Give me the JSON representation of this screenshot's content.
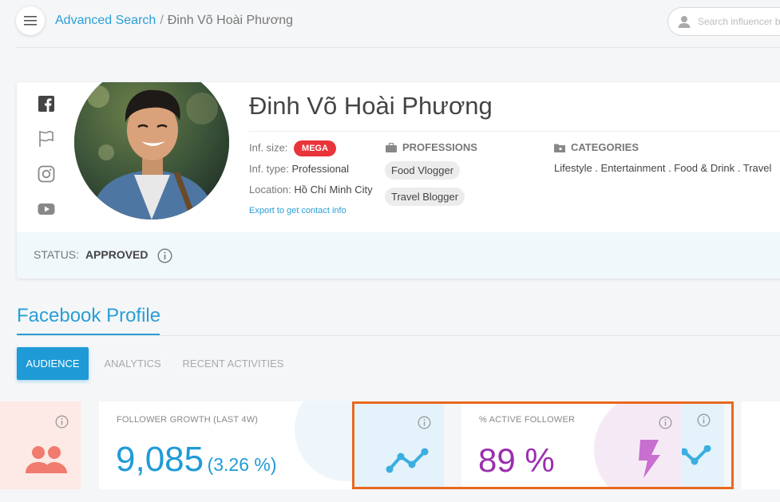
{
  "breadcrumb": {
    "parent": "Advanced Search",
    "separator": "/",
    "current": "Đinh Võ Hoài Phương"
  },
  "search": {
    "placeholder": "Search influencer by name"
  },
  "profile": {
    "name": "Đinh Võ Hoài Phương",
    "social_icons": [
      "facebook-icon",
      "flag-icon",
      "instagram-icon",
      "youtube-icon"
    ],
    "inf_size_label": "Inf. size:",
    "inf_size_badge": "MEGA",
    "inf_type_label": "Inf. type:",
    "inf_type_value": "Professional",
    "location_label": "Location:",
    "location_value": "Hồ Chí Minh City",
    "export_link": "Export to get contact info",
    "professions_heading": "PROFESSIONS",
    "professions": [
      "Food Vlogger",
      "Travel Blogger"
    ],
    "categories_heading": "CATEGORIES",
    "categories_value": "Lifestyle . Entertainment . Food & Drink . Travel",
    "status_label": "STATUS:",
    "status_value": "APPROVED"
  },
  "section": {
    "title": "Facebook Profile",
    "tabs": [
      "AUDIENCE",
      "ANALYTICS",
      "RECENT ACTIVITIES"
    ],
    "active_tab": "AUDIENCE"
  },
  "stats": {
    "follower_growth": {
      "label": "FOLLOWER GROWTH (LAST 4W)",
      "value": "9,085",
      "change": "(3.26 %)"
    },
    "active_follower": {
      "label": "% ACTIVE FOLLOWER",
      "value": "89 %"
    }
  },
  "colors": {
    "accent": "#2a9fd6",
    "badge_red": "#e9343a",
    "active_purple": "#9b2fae",
    "highlight_orange": "#e8691f"
  }
}
